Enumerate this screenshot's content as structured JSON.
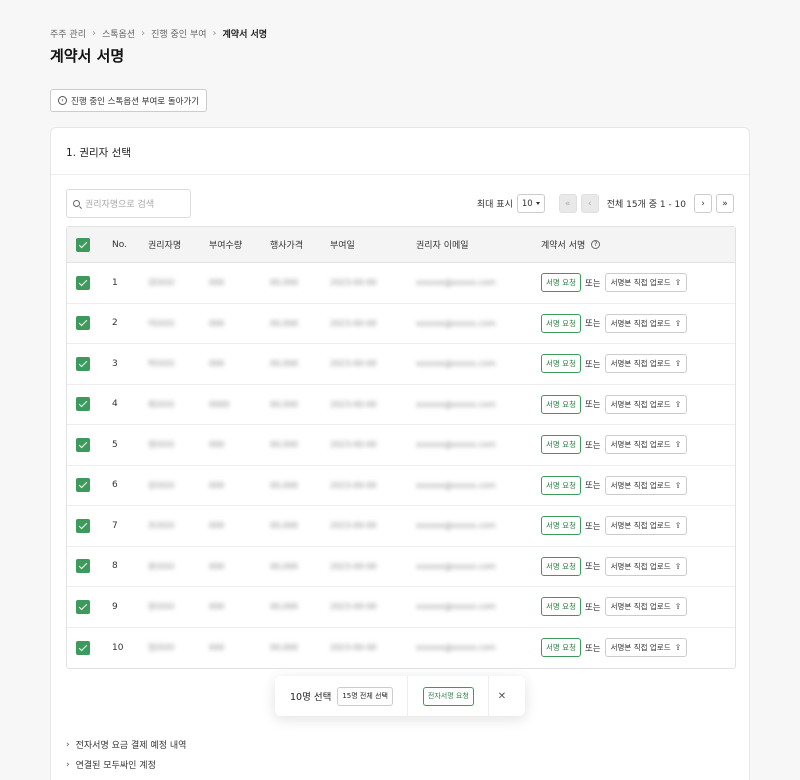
{
  "breadcrumb": [
    "주주 관리",
    "스톡옵션",
    "진행 중인 부여",
    "계약서 서명"
  ],
  "page_title": "계약서 서명",
  "back_button": "진행 중인 스톡옵션 부여로 돌아가기",
  "section_title": "1. 권리자 선택",
  "search": {
    "placeholder": "권리자명으로 검색"
  },
  "pagination": {
    "max_label": "최대 표시",
    "page_size": "10",
    "range_text": "전체 15개 중 1 - 10",
    "first": "«",
    "prev": "‹",
    "next": "›",
    "last": "»"
  },
  "table": {
    "headers": {
      "no": "No.",
      "name": "권리자명",
      "qty": "부여수량",
      "price": "행사가격",
      "date": "부여일",
      "email": "권리자 이메일",
      "sign": "계약서 서명"
    },
    "rows": [
      {
        "no": "1",
        "name": "김OOO",
        "qty": "000",
        "price": "00,000",
        "date": "2023-00-00",
        "email": "xxxxxx@xxxxx.com"
      },
      {
        "no": "2",
        "name": "이OOO",
        "qty": "000",
        "price": "00,000",
        "date": "2023-00-00",
        "email": "xxxxxx@xxxxx.com"
      },
      {
        "no": "3",
        "name": "박OOO",
        "qty": "000",
        "price": "00,000",
        "date": "2023-00-00",
        "email": "xxxxxx@xxxxx.com"
      },
      {
        "no": "4",
        "name": "최OOO",
        "qty": "0000",
        "price": "00,000",
        "date": "2023-00-00",
        "email": "xxxxxx@xxxxx.com"
      },
      {
        "no": "5",
        "name": "정OOO",
        "qty": "000",
        "price": "00,000",
        "date": "2023-00-00",
        "email": "xxxxxx@xxxxx.com"
      },
      {
        "no": "6",
        "name": "강OOO",
        "qty": "000",
        "price": "00,000",
        "date": "2023-00-00",
        "email": "xxxxxx@xxxxx.com"
      },
      {
        "no": "7",
        "name": "조OOO",
        "qty": "000",
        "price": "00,000",
        "date": "2023-00-00",
        "email": "xxxxxx@xxxxx.com"
      },
      {
        "no": "8",
        "name": "윤OOO",
        "qty": "000",
        "price": "00,000",
        "date": "2023-00-00",
        "email": "xxxxxx@xxxxx.com"
      },
      {
        "no": "9",
        "name": "장OOO",
        "qty": "000",
        "price": "00,000",
        "date": "2023-00-00",
        "email": "xxxxxx@xxxxx.com"
      },
      {
        "no": "10",
        "name": "임OOO",
        "qty": "000",
        "price": "00,000",
        "date": "2023-00-00",
        "email": "xxxxxx@xxxxx.com"
      }
    ],
    "sign_request_label": "서명 요청",
    "or_label": "또는",
    "upload_label": "서명본 직접 업로드"
  },
  "floatbar": {
    "selected": "10명 선택",
    "select_all": "15명 전체 선택",
    "esign": "전자서명 요청",
    "close": "✕"
  },
  "links": [
    "전자서명 요금 결제 예정 내역",
    "연결된 모두싸인 계정"
  ],
  "colors": {
    "accent": "#3d9a5d"
  }
}
